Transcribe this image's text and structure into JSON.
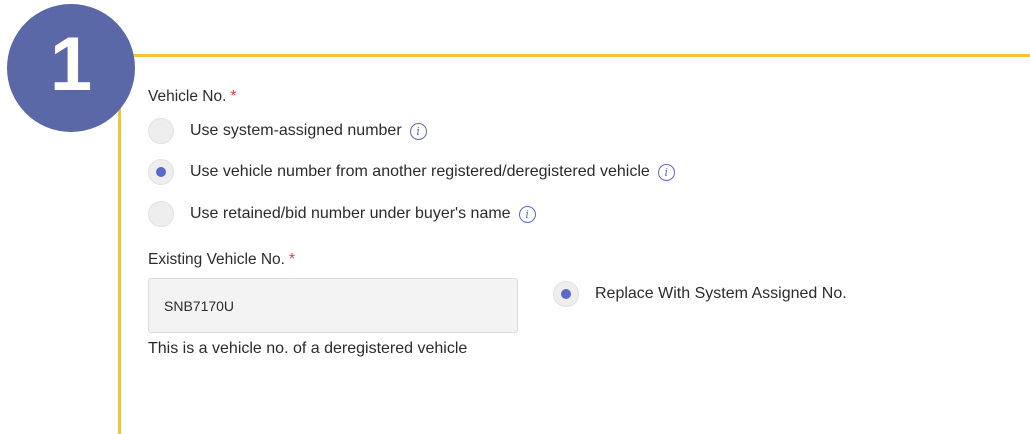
{
  "step_number": "1",
  "vehicle_no": {
    "label": "Vehicle No.",
    "required_mark": "*",
    "options": [
      {
        "label": "Use system-assigned number",
        "checked": false,
        "info": true
      },
      {
        "label": "Use vehicle number from another registered/deregistered vehicle",
        "checked": true,
        "info": true
      },
      {
        "label": "Use retained/bid number under buyer's name",
        "checked": false,
        "info": true
      }
    ]
  },
  "existing_vehicle": {
    "label": "Existing Vehicle No.",
    "required_mark": "*",
    "value": "SNB7170U",
    "hint": "This is a vehicle no. of a deregistered vehicle"
  },
  "replace_option": {
    "label": "Replace With System Assigned No.",
    "checked": true
  },
  "colors": {
    "badge": "#5a68a8",
    "panel_border": "#f5c533",
    "radio_accent": "#5a68c8",
    "required": "#e23b3b"
  },
  "icons": [
    "info-icon"
  ]
}
